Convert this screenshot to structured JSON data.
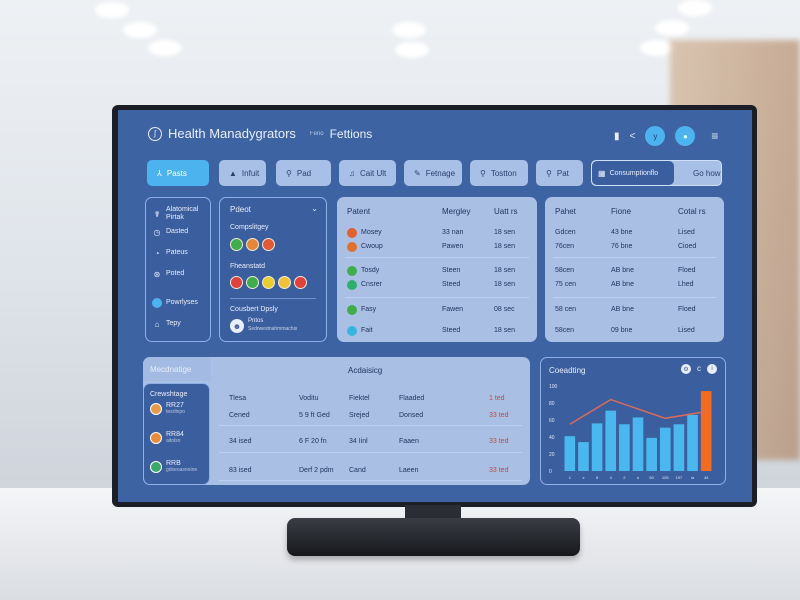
{
  "header": {
    "title": "Health Manadygrators",
    "subtitle_prefix": "Feno",
    "subtitle": "Fettions",
    "icons": [
      "document-icon",
      "share-icon",
      "user-avatar-icon",
      "profile-avatar-icon",
      "menu-icon"
    ]
  },
  "nav": {
    "tabs": [
      {
        "label": "Pasts",
        "icon": "person-icon",
        "active": true
      },
      {
        "label": "Infuit",
        "icon": "bottle-icon"
      },
      {
        "label": "Pad",
        "icon": "search-icon"
      },
      {
        "label": "Cait Ult",
        "icon": "bell-icon"
      },
      {
        "label": "Fetnage",
        "icon": "pill-icon"
      },
      {
        "label": "Tostton",
        "icon": "search-icon"
      },
      {
        "label": "Pat",
        "icon": "search-icon"
      }
    ],
    "consumption": {
      "label": "Consumptionflo",
      "icon": "calendar-icon",
      "action": "Go how"
    }
  },
  "sidebar": {
    "items": [
      {
        "label": "Alatomical Pirtak",
        "icon": "stethoscope-icon"
      },
      {
        "label": "Dasted",
        "icon": "clock-icon"
      },
      {
        "label": "Pateus",
        "icon": "gauge-icon"
      },
      {
        "label": "Poted",
        "icon": "globe-icon"
      },
      {
        "label": "Powrlyses",
        "icon": "circle-icon",
        "active": true
      },
      {
        "label": "Tepy",
        "icon": "home-icon"
      }
    ]
  },
  "patient_panel": {
    "title": "Pdeot",
    "group1": {
      "label": "Compslitgey",
      "colors": [
        "#3fae4a",
        "#e3883a",
        "#e05a3a"
      ]
    },
    "group2": {
      "label": "Fheanstatd",
      "colors": [
        "#e0413a",
        "#3fae4a",
        "#e6cf2e",
        "#f0c23c",
        "#e0413a"
      ]
    },
    "footer": {
      "label": "Cousbert Dpsly",
      "name": "Pntos",
      "detail": "Sedrwestnahmmachis"
    }
  },
  "table1": {
    "headers": [
      "Patent",
      "Mergley",
      "Uatt rs"
    ],
    "rows": [
      [
        "Mosey",
        "33 nan",
        "18 sen",
        "#e0602f"
      ],
      [
        "Cwoup",
        "Pawen",
        "18 sen",
        "#e0702f"
      ],
      [
        "Tosdy",
        "Steen",
        "18 sen",
        "#3fae4a"
      ],
      [
        "Cnsrer",
        "Steed",
        "18 sen",
        "#2fae6a"
      ],
      [
        "Fasy",
        "Fawen",
        "08 sec",
        "#3fae4a"
      ],
      [
        "Fait",
        "Steed",
        "18 sen",
        "#37b5e0"
      ]
    ]
  },
  "table2": {
    "headers": [
      "Pahet",
      "Fione",
      "Cotal rs"
    ],
    "rows": [
      [
        "Gdcen",
        "43 bne",
        "Lised"
      ],
      [
        "76cen",
        "76 bne",
        "Cioed"
      ],
      [
        "58cen",
        "AB bne",
        "Floed"
      ],
      [
        "75 cen",
        "AB bne",
        "Lhed"
      ],
      [
        "58 cen",
        "AB bne",
        "Floed"
      ],
      [
        "58cen",
        "09 bne",
        "Lised"
      ]
    ]
  },
  "activity": {
    "left_title": "Mecdnatige",
    "title": "Acdaisicg",
    "sub_label": "Crewshtage",
    "people": [
      {
        "code": "RR27",
        "detail": "tesrilnpo",
        "color": "#e79a4a"
      },
      {
        "code": "RR84",
        "detail": "aitolsn",
        "color": "#e98c3c"
      },
      {
        "code": "RRB",
        "detail": "gdseoasnoine",
        "color": "#3aa86a"
      }
    ],
    "rows": [
      [
        "Tlesa",
        "Voditu",
        "Fiektel",
        "Flaaded",
        "1 ted"
      ],
      [
        "Cened",
        "5 9 ft Ged",
        "Srejed",
        "Donsed",
        "33 ted"
      ],
      [
        "34 ised",
        "6 F 20 fn",
        "34 Iinl",
        "Faaen",
        "33 ted"
      ],
      [
        "83 ised",
        "Derf 2 pdm",
        "Cand",
        "Laeen",
        "33 ted"
      ]
    ]
  },
  "chart_data": {
    "type": "bar",
    "title": "Coeadting",
    "icons": [
      "settings-icon",
      "refresh-icon",
      "info-icon"
    ],
    "categories": [
      "1",
      "x",
      "8",
      "4",
      "2",
      "n",
      "50",
      "105",
      "197",
      "ia",
      "44"
    ],
    "values": [
      41,
      34,
      56,
      71,
      55,
      63,
      39,
      51,
      55,
      66,
      94
    ],
    "line_values": [
      55,
      null,
      null,
      84,
      null,
      null,
      null,
      62,
      null,
      null,
      70
    ],
    "highlight_index": 10,
    "ylim": [
      0,
      100
    ],
    "yticks": [
      "0",
      "20",
      "40",
      "60",
      "80",
      "100"
    ],
    "colors": {
      "bar": "#4ab8ef",
      "highlight": "#f26b21",
      "line": "#d96b5a"
    }
  }
}
